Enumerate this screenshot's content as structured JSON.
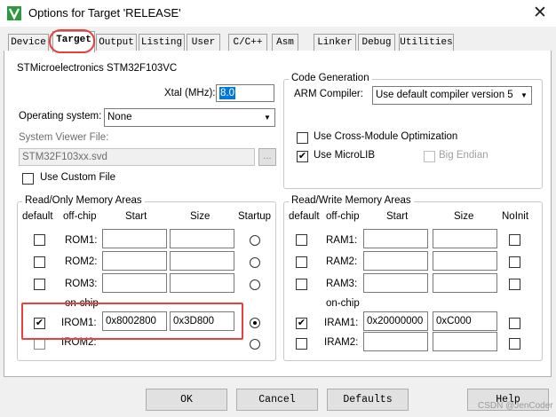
{
  "window": {
    "title": "Options for Target 'RELEASE'",
    "app_icon": "keil-uvision-icon",
    "close_glyph": "✕"
  },
  "tabs": [
    {
      "label": "Device"
    },
    {
      "label": "Target"
    },
    {
      "label": "Output"
    },
    {
      "label": "Listing"
    },
    {
      "label": "User"
    },
    {
      "label": "C/C++"
    },
    {
      "label": "Asm"
    },
    {
      "label": "Linker"
    },
    {
      "label": "Debug"
    },
    {
      "label": "Utilities"
    }
  ],
  "active_tab": "Target",
  "device": "STMicroelectronics STM32F103VC",
  "xtal": {
    "label": "Xtal (MHz):",
    "value": "8.0"
  },
  "os": {
    "label": "Operating system:",
    "value": "None"
  },
  "svd": {
    "label": "System Viewer File:",
    "value": "STM32F103xx.svd",
    "browse": "...",
    "custom_label": "Use Custom File",
    "custom_checked": false
  },
  "codegen": {
    "title": "Code Generation",
    "compiler_label": "ARM Compiler:",
    "compiler_value": "Use default compiler version 5",
    "cross_module": {
      "label": "Use Cross-Module Optimization",
      "checked": false
    },
    "microlib": {
      "label": "Use MicroLIB",
      "checked": true
    },
    "big_endian": {
      "label": "Big Endian",
      "checked": false
    }
  },
  "rom": {
    "title": "Read/Only Memory Areas",
    "headers": {
      "default": "default",
      "offchip": "off-chip",
      "start": "Start",
      "size": "Size",
      "startup": "Startup"
    },
    "onchip_label": "on-chip",
    "rows": [
      {
        "label": "ROM1:",
        "start": "",
        "size": "",
        "default": false,
        "startup": false
      },
      {
        "label": "ROM2:",
        "start": "",
        "size": "",
        "default": false,
        "startup": false
      },
      {
        "label": "ROM3:",
        "start": "",
        "size": "",
        "default": false,
        "startup": false
      },
      {
        "label": "IROM1:",
        "start": "0x8002800",
        "size": "0x3D800",
        "default": true,
        "startup": true
      },
      {
        "label": "IROM2:",
        "start": "",
        "size": "",
        "default": false,
        "startup": false
      }
    ]
  },
  "ram": {
    "title": "Read/Write Memory Areas",
    "headers": {
      "default": "default",
      "offchip": "off-chip",
      "start": "Start",
      "size": "Size",
      "noinit": "NoInit"
    },
    "onchip_label": "on-chip",
    "rows": [
      {
        "label": "RAM1:",
        "start": "",
        "size": "",
        "default": false,
        "noinit": false
      },
      {
        "label": "RAM2:",
        "start": "",
        "size": "",
        "default": false,
        "noinit": false
      },
      {
        "label": "RAM3:",
        "start": "",
        "size": "",
        "default": false,
        "noinit": false
      },
      {
        "label": "IRAM1:",
        "start": "0x20000000",
        "size": "0xC000",
        "default": true,
        "noinit": false
      },
      {
        "label": "IRAM2:",
        "start": "",
        "size": "",
        "default": false,
        "noinit": false
      }
    ]
  },
  "buttons": {
    "ok": "OK",
    "cancel": "Cancel",
    "defaults": "Defaults",
    "help": "Help"
  },
  "watermark": "CSDN @JenCoder",
  "colors": {
    "highlight": "#e8403f",
    "selection": "#0078d7"
  }
}
